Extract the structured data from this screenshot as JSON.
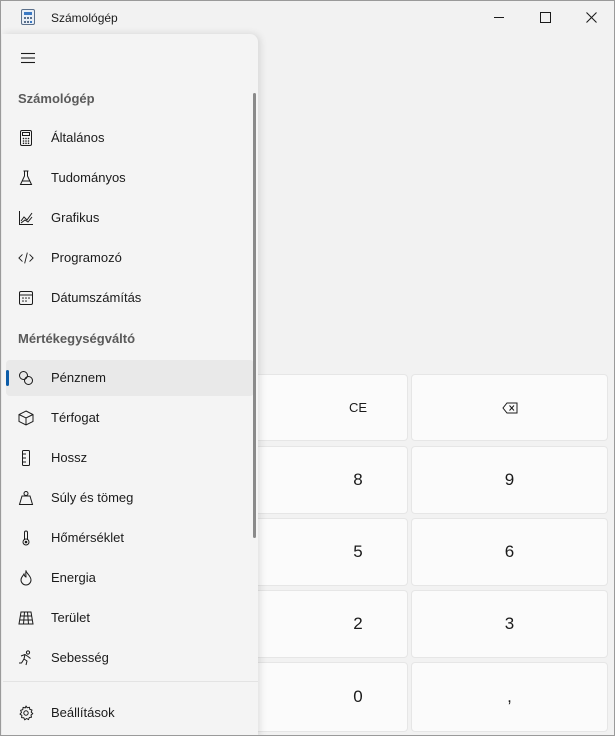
{
  "window": {
    "title": "Számológép"
  },
  "nav": {
    "section_calculator": "Számológép",
    "section_converter": "Mértékegységváltó",
    "calculator_items": [
      {
        "label": "Általános",
        "icon": "calculator-icon"
      },
      {
        "label": "Tudományos",
        "icon": "flask-icon"
      },
      {
        "label": "Grafikus",
        "icon": "graph-icon"
      },
      {
        "label": "Programozó",
        "icon": "code-icon"
      },
      {
        "label": "Dátumszámítás",
        "icon": "calendar-icon"
      }
    ],
    "converter_items": [
      {
        "label": "Pénznem",
        "icon": "currency-icon",
        "selected": true
      },
      {
        "label": "Térfogat",
        "icon": "cube-icon"
      },
      {
        "label": "Hossz",
        "icon": "ruler-icon"
      },
      {
        "label": "Súly és tömeg",
        "icon": "weight-icon"
      },
      {
        "label": "Hőmérséklet",
        "icon": "thermometer-icon"
      },
      {
        "label": "Energia",
        "icon": "flame-icon"
      },
      {
        "label": "Terület",
        "icon": "area-icon"
      },
      {
        "label": "Sebesség",
        "icon": "runner-icon"
      }
    ],
    "settings_label": "Beállítások"
  },
  "keypad": {
    "ce": "CE",
    "backspace_icon": "backspace-icon",
    "k8": "8",
    "k9": "9",
    "k5": "5",
    "k6": "6",
    "k2": "2",
    "k3": "3",
    "k0": "0",
    "decimal": ","
  },
  "colors": {
    "accent": "#0c5ca8",
    "nav_background": "#f4f4f4",
    "key_background": "#fbfbfb"
  }
}
